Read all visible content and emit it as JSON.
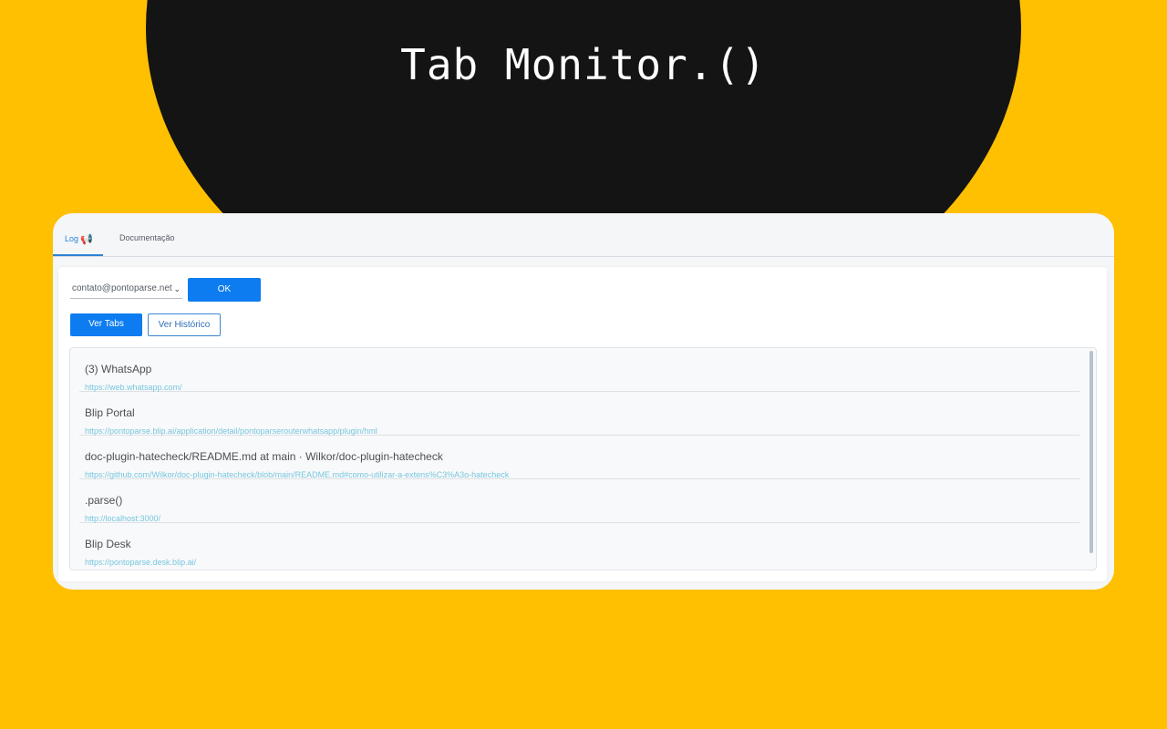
{
  "hero": {
    "title": "Tab Monitor.()"
  },
  "tabs": [
    {
      "label": "Log",
      "active": true,
      "icon": "megaphone-icon"
    },
    {
      "label": "Documentação",
      "active": false
    }
  ],
  "controls": {
    "account_select_value": "contato@pontoparse.net",
    "ok_label": "OK",
    "view_tabs_label": "Ver Tabs",
    "view_history_label": "Ver Histórico"
  },
  "tab_list": [
    {
      "title": "(3) WhatsApp",
      "url": "https://web.whatsapp.com/"
    },
    {
      "title": "Blip Portal",
      "url": "https://pontoparse.blip.ai/application/detail/pontoparserouterwhatsapp/plugin/hml"
    },
    {
      "title": "doc-plugin-hatecheck/README.md at main · Wilkor/doc-plugin-hatecheck",
      "url": "https://github.com/Wilkor/doc-plugin-hatecheck/blob/main/README.md#como-utilizar-a-extens%C3%A3o-hatecheck"
    },
    {
      "title": ".parse()",
      "url": "http://localhost:3000/"
    },
    {
      "title": "Blip Desk",
      "url": "https://pontoparse.desk.blip.ai/"
    }
  ],
  "colors": {
    "background": "#FFC001",
    "blob": "#141414",
    "primary": "#0d7cf0",
    "link": "#76c6df"
  }
}
